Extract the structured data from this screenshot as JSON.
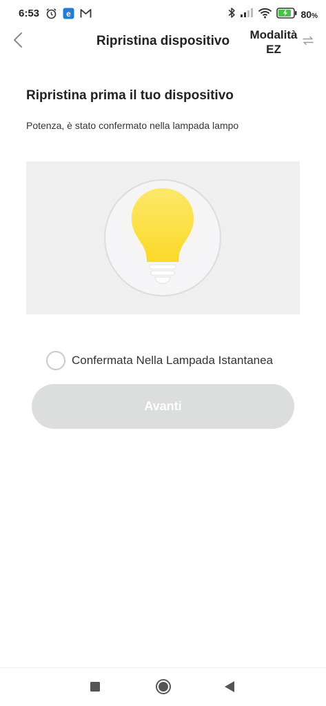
{
  "status_bar": {
    "time": "6:53",
    "battery_percent": "80",
    "battery_unit": "%",
    "left_icons": [
      "alarm-icon",
      "edge-app-icon",
      "gmail-icon"
    ],
    "right_icons": [
      "bluetooth-icon",
      "signal-icon",
      "wifi-icon",
      "battery-icon"
    ]
  },
  "header": {
    "title": "Ripristina dispositivo",
    "ez_mode_line1": "Modalità",
    "ez_mode_line2": "EZ",
    "back_icon": "chevron-left-icon",
    "switch_icon": "switch-arrows-icon"
  },
  "content": {
    "heading": "Ripristina prima il tuo dispositivo",
    "description": "Potenza, è stato confermato nella lampada lampo",
    "illustration": "light-bulb-icon"
  },
  "confirm": {
    "label": "Confermata Nella Lampada Istantanea",
    "checked": false
  },
  "next_button": {
    "label": "Avanti",
    "enabled": false
  },
  "colors": {
    "accent_disabled": "#dcdedd",
    "bulb_yellow": "#fce34a",
    "panel_bg": "#efefef",
    "battery_green": "#44c24a"
  },
  "nav_bar": {
    "items": [
      "recents-square-icon",
      "home-circle-icon",
      "back-triangle-icon"
    ]
  }
}
